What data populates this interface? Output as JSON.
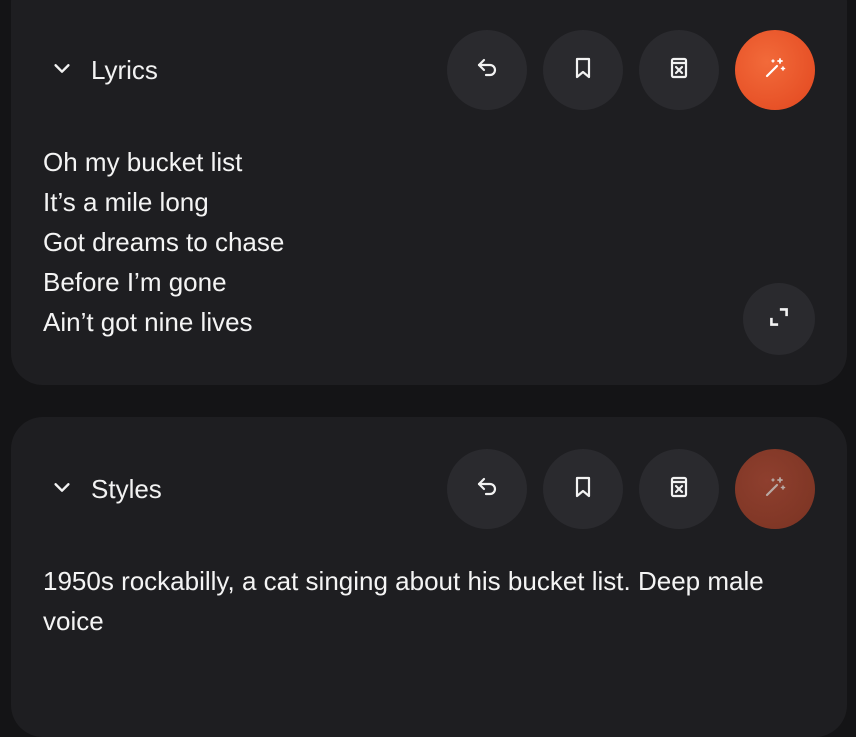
{
  "lyrics": {
    "title": "Lyrics",
    "lines": [
      "Oh my bucket list",
      "It’s a mile long",
      "Got dreams to chase",
      "Before I’m gone",
      "Ain’t got nine lives"
    ],
    "icons": [
      "chevron-down-icon",
      "undo-icon",
      "bookmark-icon",
      "clear-icon",
      "magic-wand-icon",
      "expand-icon"
    ]
  },
  "styles": {
    "title": "Styles",
    "text": "1950s rockabilly, a cat singing about his bucket list. Deep male voice",
    "icons": [
      "chevron-down-icon",
      "undo-icon",
      "bookmark-icon",
      "clear-icon",
      "magic-wand-icon"
    ]
  },
  "colors": {
    "page_bg": "#141416",
    "card_bg": "#1e1e21",
    "button_bg": "#2a2a2e",
    "accent": "#e9552a"
  }
}
